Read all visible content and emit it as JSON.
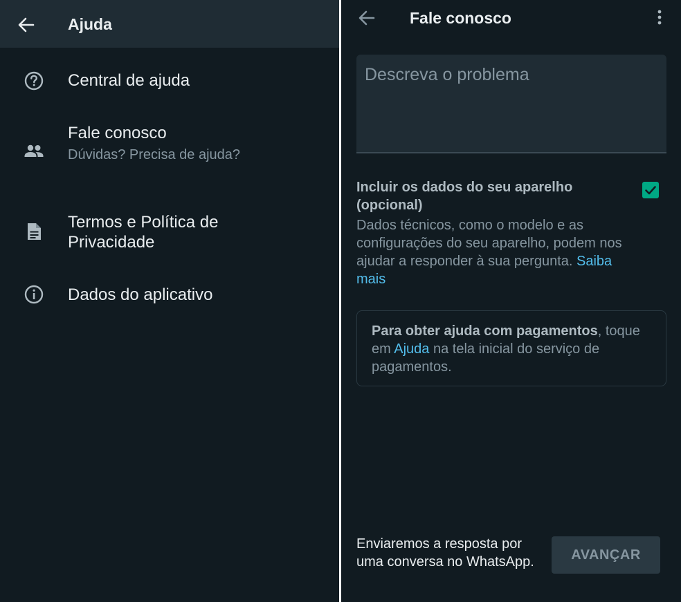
{
  "left": {
    "appbar": {
      "title": "Ajuda"
    },
    "items": [
      {
        "icon": "help-circle-icon",
        "title": "Central de ajuda"
      },
      {
        "icon": "people-icon",
        "title": "Fale conosco",
        "subtitle": "Dúvidas? Precisa de ajuda?"
      },
      {
        "icon": "document-icon",
        "title": "Termos e Política de Privacidade"
      },
      {
        "icon": "info-icon",
        "title": "Dados do aplicativo"
      }
    ]
  },
  "right": {
    "appbar": {
      "title": "Fale conosco"
    },
    "description": {
      "placeholder": "Descreva o problema"
    },
    "include": {
      "title": "Incluir os dados do seu aparelho (opcional)",
      "description": "Dados técnicos, como o modelo e as configurações do seu aparelho, podem nos ajudar a responder à sua pergunta.",
      "link": "Saiba mais",
      "checked": true
    },
    "payment_card": {
      "bold": "Para obter ajuda com pagamentos",
      "text_before_link": ", toque em ",
      "link": "Ajuda",
      "text_after_link": " na tela inicial do serviço de pagamentos."
    },
    "footer": {
      "text": "Enviaremos a resposta por uma conversa no WhatsApp.",
      "button": "AVANÇAR"
    }
  },
  "colors": {
    "background": "#111b21",
    "appbar": "#1f2c34",
    "accent": "#00a884",
    "link": "#53bdeb",
    "primary_text": "#e9edef",
    "secondary_text": "#8696a0"
  }
}
